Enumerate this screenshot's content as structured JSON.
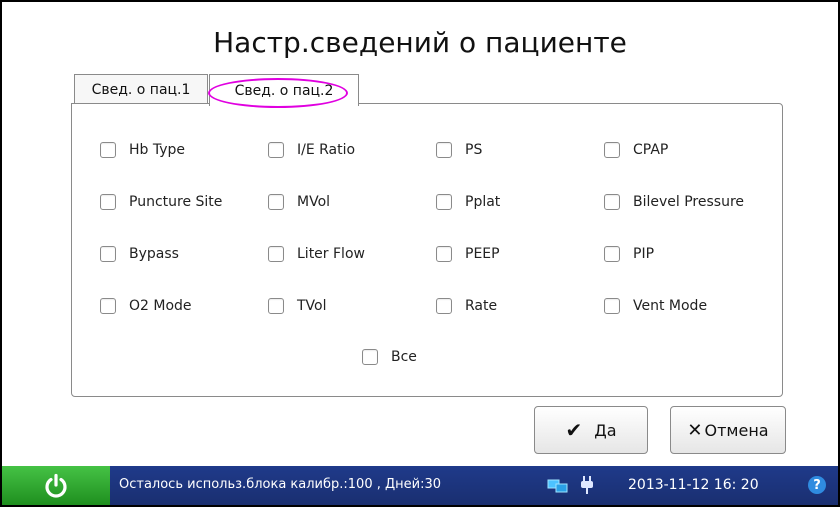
{
  "title": "Настр.сведений о пациенте",
  "tabs": [
    {
      "label": "Свед. о пац.1"
    },
    {
      "label": "Свед. о пац.2"
    }
  ],
  "checkboxes": {
    "hb_type": "Hb Type",
    "ie_ratio": "I/E Ratio",
    "ps": "PS",
    "cpap": "CPAP",
    "puncture_site": "Puncture Site",
    "mvol": "MVol",
    "pplat": "Pplat",
    "bilevel": "Bilevel Pressure",
    "bypass": "Bypass",
    "liter_flow": "Liter Flow",
    "peep": "PEEP",
    "pip": "PIP",
    "o2_mode": "O2 Mode",
    "tvol": "TVol",
    "rate": "Rate",
    "vent_mode": "Vent Mode",
    "all": "Все"
  },
  "buttons": {
    "ok_label": "Да",
    "cancel_label": "Отмена"
  },
  "status": {
    "calibration_text": "Осталось использ.блока калибр.:100 , Дней:30",
    "datetime": "2013-11-12  16: 20",
    "help": "?"
  },
  "colors": {
    "status_bar": "#1f3a8a",
    "power_button": "#2ea52e",
    "tab_highlight": "#e000e0"
  }
}
